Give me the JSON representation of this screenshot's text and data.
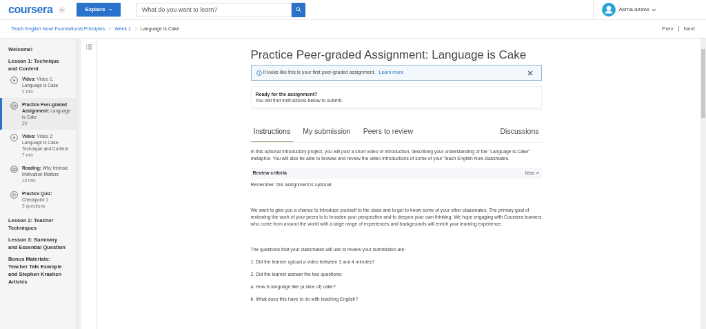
{
  "header": {
    "logo": "coursera",
    "explore": "Explore",
    "search": {
      "placeholder": "What do you want to learn?"
    },
    "user": "Asma alrawi"
  },
  "breadcrumb": {
    "items": [
      "Teach English Now! Foundational Principles",
      "Week 1",
      "Language is Cake"
    ],
    "prev": "Prev",
    "next": "Next"
  },
  "sidebar": {
    "sections": [
      {
        "title": "Welcome!"
      },
      {
        "title": "Lesson 1: Technique and Content",
        "items": [
          {
            "kind": "video",
            "type_label": "Video:",
            "title": "Video 1: Language is Cake",
            "meta": "2 min",
            "selected": false
          },
          {
            "kind": "peer",
            "type_label": "Practice Peer-graded Assignment:",
            "title": "Language is Cake",
            "meta": "2h",
            "selected": true
          },
          {
            "kind": "video",
            "type_label": "Video:",
            "title": "Video 2: Language is Cake: Technique and Content",
            "meta": "7 min",
            "selected": false
          },
          {
            "kind": "reading",
            "type_label": "Reading:",
            "title": "Why Intrinsic Motivation Matters",
            "meta": "10 min",
            "selected": false
          },
          {
            "kind": "quiz",
            "type_label": "Practice Quiz:",
            "title": "Checkpoint 1",
            "meta": "3 questions",
            "selected": false
          }
        ]
      },
      {
        "title": "Lesson 2: Teacher Techniques"
      },
      {
        "title": "Lesson 3: Summary and Essential Question"
      },
      {
        "title": "Bonus Materials: Teacher Talk Example and Stephen Krashen Articles"
      }
    ]
  },
  "main": {
    "title": "Practice Peer-graded Assignment: Language is Cake",
    "notice": {
      "text": "It looks like this is your first peer-graded assignment.",
      "link": "Learn more"
    },
    "ready": {
      "title": "Ready for the assignment?",
      "text": "You will find instructions below to submit."
    },
    "tabs": [
      {
        "label": "Instructions",
        "selected": true
      },
      {
        "label": "My submission",
        "selected": false
      },
      {
        "label": "Peers to review",
        "selected": false
      },
      {
        "label": "Discussions",
        "selected": false
      }
    ],
    "intro": "In this optional introductory project, you will post a short video of introduction, describing your understanding of the \"Language is Cake\" metaphor. You will also be able to browse and review the video introductions of some of your Teach English Now classmates.",
    "criteria": {
      "title": "Review criteria",
      "toggle": "less",
      "expanded": true
    },
    "paragraphs": [
      "Remember: this assignment is optional.",
      "We want to give you a chance to introduce yourself to the class and to get to know some of your other classmates. The primary goal of reviewing the work of your peers is to broaden your perspective and to deepen your own thinking. We hope engaging with Coursera learners who come from around the world with a large range of experiences and backgrounds will enrich your learning experience.",
      "The questions that your classmates will use to review your submission are:",
      "1. Did the learner upload a video between 1 and 4 minutes?",
      "2. Did the learner answer the two questions:",
      "a. How is language like (a slice of) cake?",
      "b. What does this have to do with teaching English?"
    ]
  }
}
